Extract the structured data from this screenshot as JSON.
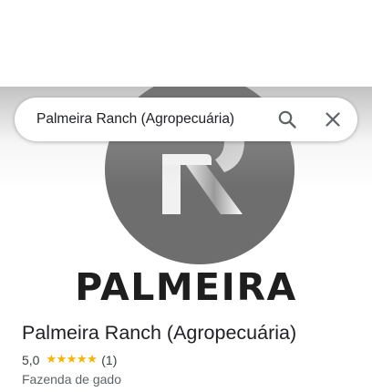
{
  "search": {
    "query": "Palmeira Ranch (Agropecuária)"
  },
  "hero": {
    "logo_letter": "R",
    "wordmark": "PALMEIRA"
  },
  "place": {
    "name": "Palmeira Ranch (Agropecuária)",
    "rating_text": "5,0",
    "rating_value": 5.0,
    "stars": [
      "★",
      "★",
      "★",
      "★",
      "★"
    ],
    "review_count": "(1)",
    "category": "Fazenda de gado"
  },
  "colors": {
    "star": "#f5b400",
    "logo_circle": "#6e6e6e",
    "wordmark": "#1e1e1e"
  },
  "icons": {
    "search": "search-icon",
    "close": "close-icon"
  }
}
